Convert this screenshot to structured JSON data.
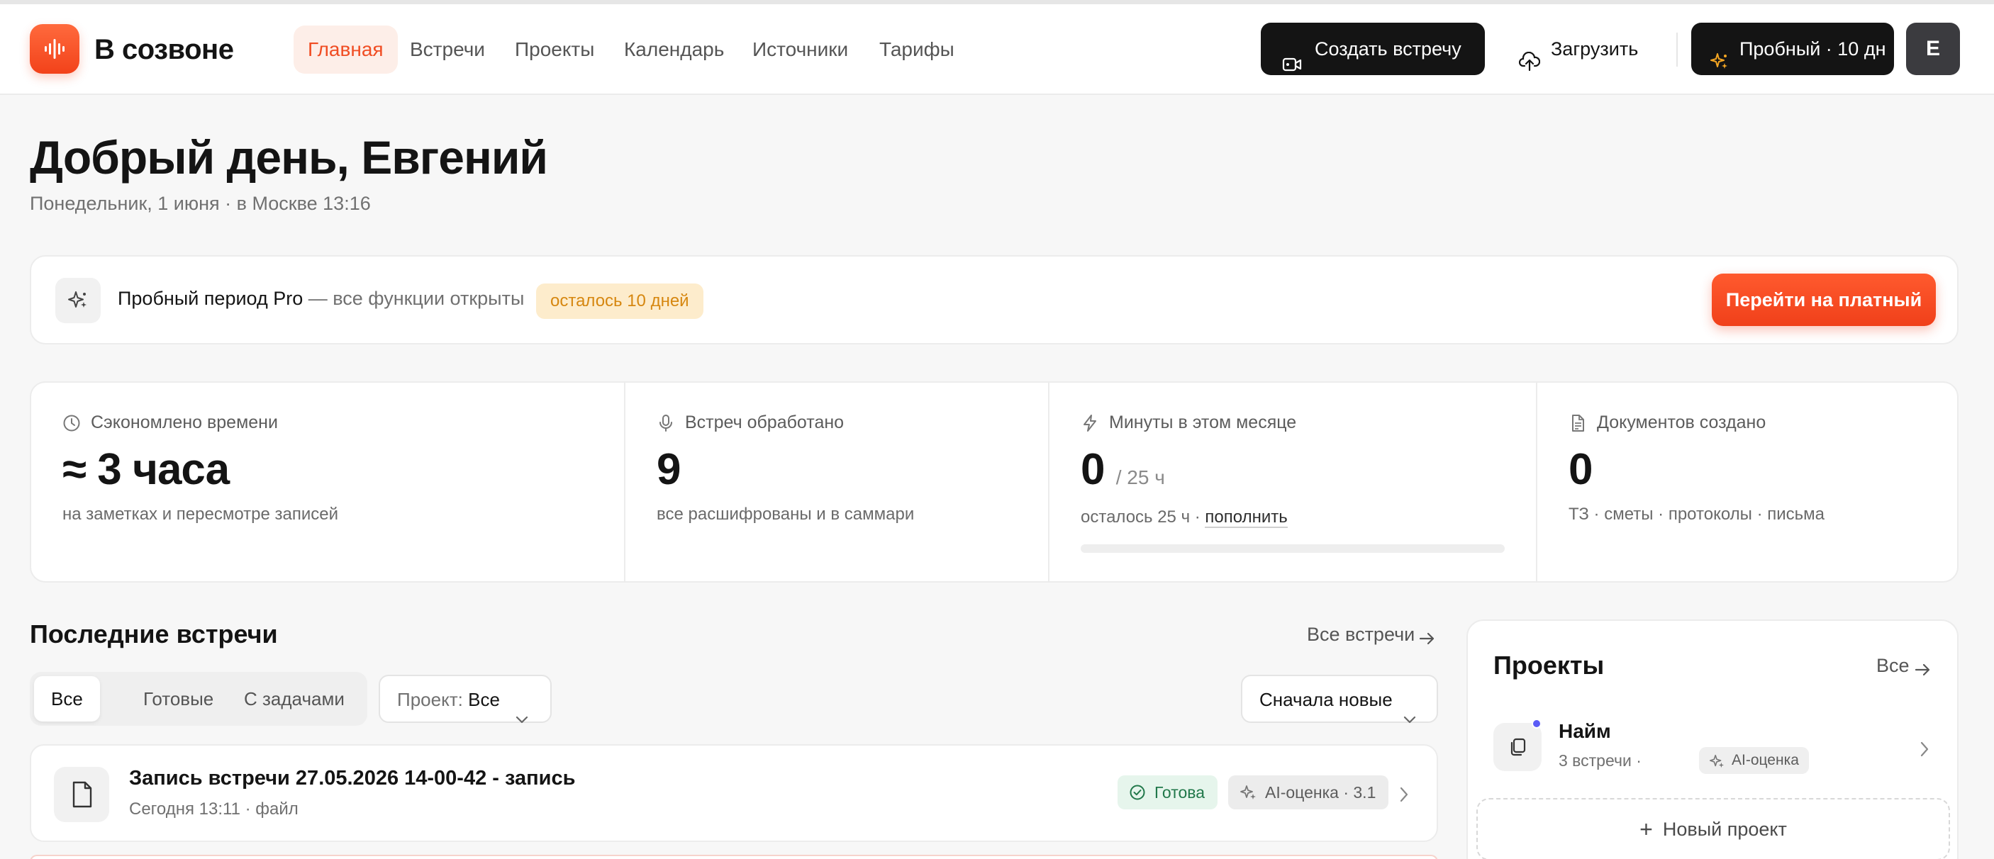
{
  "app": {
    "name": "В созвоне",
    "accent": "#f04d23"
  },
  "nav": {
    "items": [
      {
        "label": "Главная",
        "active": true
      },
      {
        "label": "Встречи",
        "active": false
      },
      {
        "label": "Проекты",
        "active": false
      },
      {
        "label": "Календарь",
        "active": false
      },
      {
        "label": "Источники",
        "active": false
      },
      {
        "label": "Тарифы",
        "active": false
      }
    ]
  },
  "header_actions": {
    "create_label": "Создать встречу",
    "create_icon": "video-icon",
    "upload_label": "Загрузить",
    "upload_icon": "cloud-upload-icon",
    "trial_label": "Пробный · 10 дн",
    "trial_icon": "sparkles-icon",
    "avatar_initial": "Е"
  },
  "greeting": {
    "title": "Добрый день, Евгений",
    "subtitle": "Понедельник, 1 июня · в Москве 13:16"
  },
  "trial_banner": {
    "icon": "sparkles-icon",
    "title": "Пробный период Pro",
    "description": " — все функции открыты",
    "badge": "осталось 10 дней",
    "cta": "Перейти на платный"
  },
  "stats": [
    {
      "icon": "clock-icon",
      "label": "Сэкономлено времени",
      "value": "≈ 3 часа",
      "note": "на заметках и пересмотре записей"
    },
    {
      "icon": "microphone-icon",
      "label": "Встреч обработано",
      "value": "9",
      "note": "все расшифрованы и в саммари"
    },
    {
      "icon": "lightning-icon",
      "label": "Минуты в этом месяце",
      "value": "0",
      "unit": "/ 25 ч",
      "note": "осталось 25 ч · ",
      "note_link": "пополнить",
      "progress": 0
    },
    {
      "icon": "document-icon",
      "label": "Документов создано",
      "value": "0",
      "note": "ТЗ · сметы · протоколы · письма"
    }
  ],
  "recent": {
    "title": "Последние встречи",
    "all_link": "Все встречи",
    "filters": [
      "Все",
      "Готовые",
      "С задачами"
    ],
    "active_filter": 0,
    "project_filter_label": "Проект:",
    "project_filter_value": "Все",
    "sort_value": "Сначала новые",
    "meetings": [
      {
        "icon": "file-icon",
        "title": "Запись встречи 27.05.2026 14-00-42 - запись",
        "meta": "Сегодня 13:11 · файл",
        "status": "Готова",
        "status_color": "#21784a",
        "ai_score": "AI-оценка · 3.1"
      }
    ]
  },
  "projects": {
    "title": "Проекты",
    "all_link": "Все",
    "items": [
      {
        "icon": "copy-icon",
        "name": "Найм",
        "meta": "3 встречи ·",
        "badge": "AI-оценка",
        "dot_color": "#5b5cf6"
      }
    ],
    "new_label": "Новый проект"
  }
}
